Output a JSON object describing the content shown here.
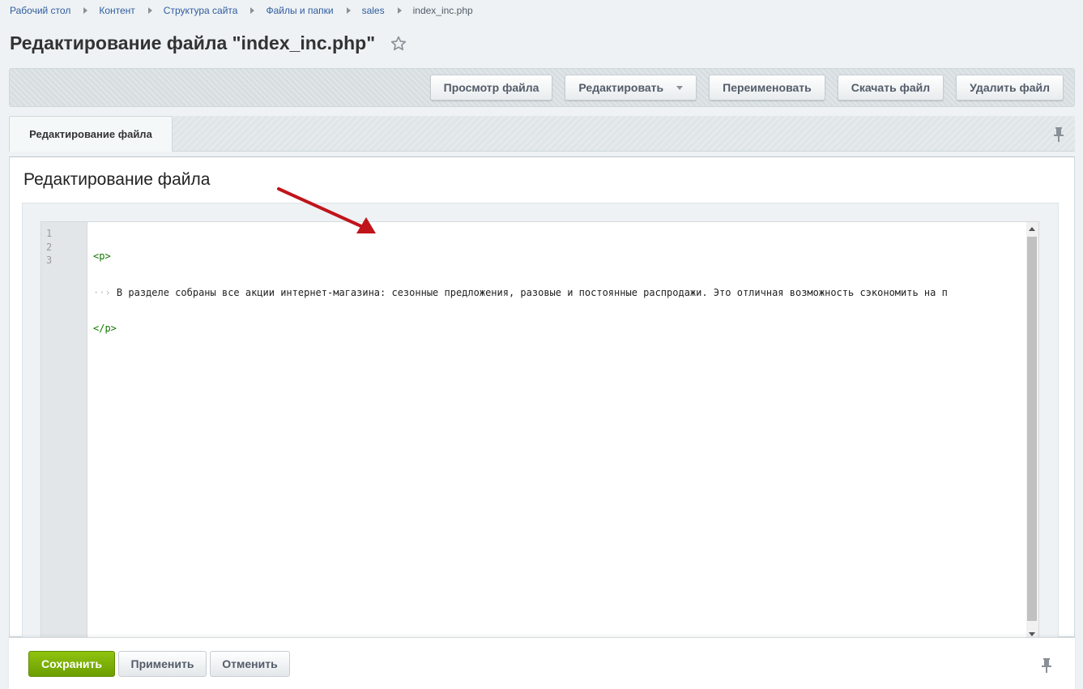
{
  "breadcrumb": {
    "items": [
      "Рабочий стол",
      "Контент",
      "Структура сайта",
      "Файлы и папки",
      "sales"
    ],
    "current": "index_inc.php"
  },
  "page": {
    "title": "Редактирование файла \"index_inc.php\"",
    "favorite_icon": "star-icon"
  },
  "toolbar": {
    "view_label": "Просмотр файла",
    "edit_label": "Редактировать",
    "rename_label": "Переименовать",
    "download_label": "Скачать файл",
    "delete_label": "Удалить файл"
  },
  "tabs": {
    "active_label": "Редактирование файла",
    "pin_icon": "pin-icon"
  },
  "section": {
    "title": "Редактирование файла"
  },
  "editor": {
    "line_numbers": [
      "1",
      "2",
      "3"
    ],
    "lines": {
      "open_tag": "<p>",
      "indent": "··›",
      "text": "В разделе собраны все акции интернет-магазина: сезонные предложения, разовые и постоянные распродажи. Это отличная возможность сэкономить на п",
      "close_tag": "</p>"
    }
  },
  "footer": {
    "save_label": "Сохранить",
    "apply_label": "Применить",
    "cancel_label": "Отменить"
  },
  "colors": {
    "accent_green": "#7db500",
    "arrow_red": "#c0141b",
    "tag_green": "#117700",
    "link_blue": "#2f5ca0"
  }
}
